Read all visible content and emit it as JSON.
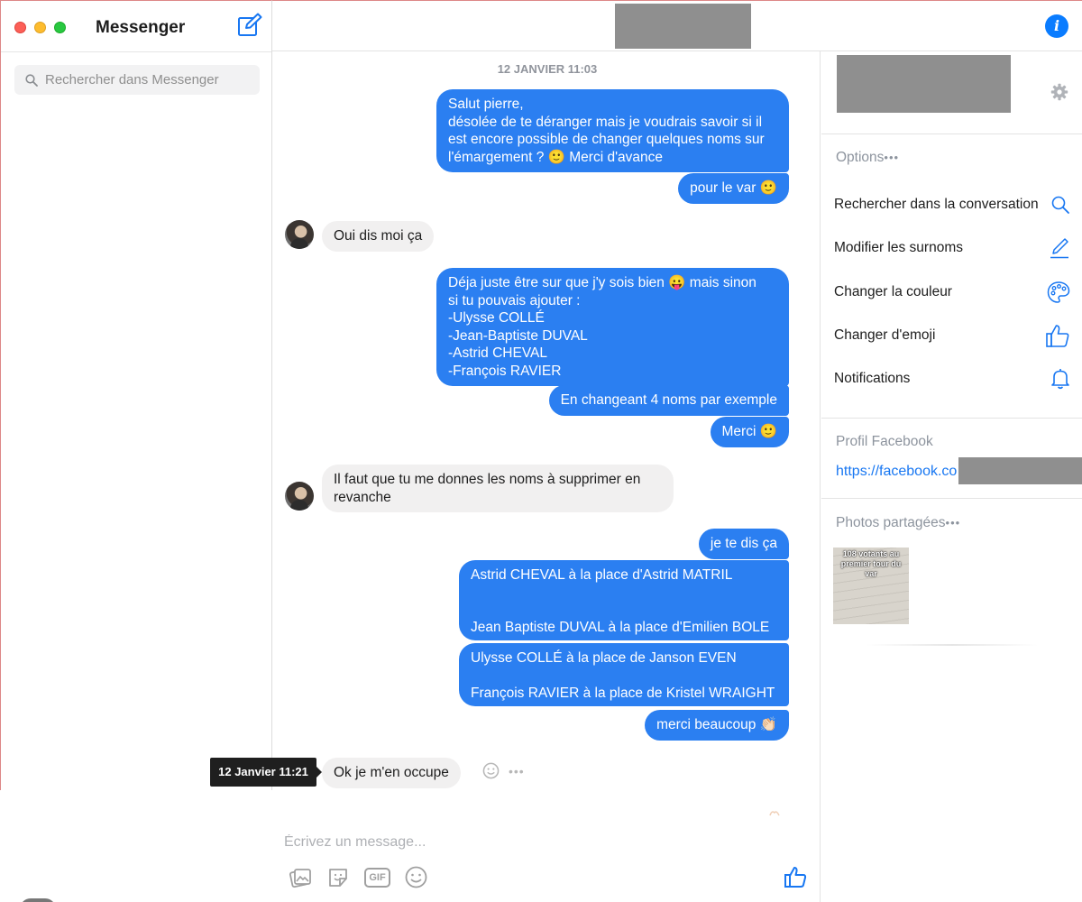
{
  "app_title": "Messenger",
  "search": {
    "placeholder": "Rechercher dans Messenger"
  },
  "header": {
    "info_icon": "i"
  },
  "conversation": {
    "timestamp": "12 JANVIER 11:03",
    "messages": [
      {
        "lines": [
          "Salut pierre,",
          "désolée de te déranger mais je voudrais savoir si il",
          "est encore possible de changer quelques noms sur",
          "l'émargement ? 🙂 Merci d'avance"
        ]
      },
      {
        "text": "pour le var 🙂"
      },
      {
        "text": "Oui dis moi ça"
      },
      {
        "lines": [
          "Déja juste être sur que j'y sois bien 😛 mais sinon",
          "si tu pouvais ajouter :",
          "-Ulysse COLLÉ",
          "-Jean-Baptiste DUVAL",
          "-Astrid CHEVAL",
          "-François RAVIER"
        ]
      },
      {
        "text": "En changeant 4 noms par exemple"
      },
      {
        "text": "Merci 🙂"
      },
      {
        "lines": [
          "Il faut que tu me donnes les noms à supprimer en",
          "revanche"
        ]
      },
      {
        "text": "je te dis ça"
      },
      {
        "lines": [
          "Astrid CHEVAL à la place d'Astrid MATRIL",
          "Jean Baptiste DUVAL à la place d'Emilien BOLE"
        ]
      },
      {
        "lines": [
          "Ulysse COLLÉ à la place de Janson EVEN",
          "François RAVIER à la place de Kristel WRAIGHT"
        ]
      },
      {
        "text": "merci beaucoup 👏🏻"
      },
      {
        "text": "Ok je m'en occupe"
      }
    ],
    "tooltip": "12 Janvier 11:21",
    "more": "•••"
  },
  "composer": {
    "placeholder": "Écrivez un message...",
    "gif_label": "GIF"
  },
  "panel": {
    "options_title": "Options",
    "dots": "•••",
    "options": [
      {
        "label": "Rechercher dans la conversation",
        "icon": "search-icon"
      },
      {
        "label": "Modifier les surnoms",
        "icon": "pencil-icon"
      },
      {
        "label": "Changer la couleur",
        "icon": "palette-icon"
      },
      {
        "label": "Changer d'emoji",
        "icon": "thumbs-up-icon"
      },
      {
        "label": "Notifications",
        "icon": "bell-icon"
      }
    ],
    "profile_title": "Profil Facebook",
    "profile_link": "https://facebook.co",
    "photos_title": "Photos partagées",
    "photo_caption": "108 votants au premier tour du var"
  },
  "colors": {
    "accent": "#0a7cff",
    "bubble_out": "#2b7ff1",
    "bubble_in": "#f1f0f0"
  }
}
